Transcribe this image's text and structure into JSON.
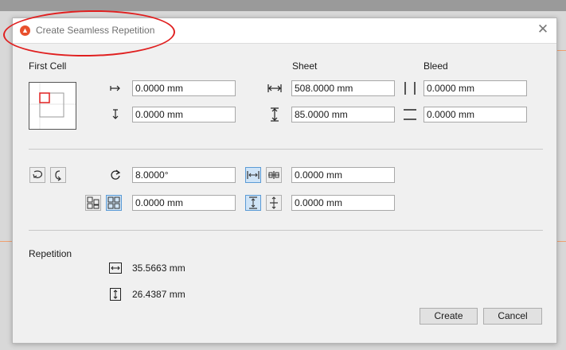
{
  "dialog": {
    "title": "Create Seamless Repetition"
  },
  "first_cell": {
    "heading": "First Cell",
    "x_offset": "0.0000 mm",
    "y_offset": "0.0000 mm"
  },
  "sheet": {
    "heading": "Sheet",
    "width": "508.0000 mm",
    "height": "85.0000 mm"
  },
  "bleed": {
    "heading": "Bleed",
    "horizontal": "0.0000 mm",
    "vertical": "0.0000 mm"
  },
  "transform": {
    "rotation": "8.0000°",
    "offset": "0.0000 mm",
    "h_spacing": "0.0000 mm",
    "v_spacing": "0.0000 mm"
  },
  "repetition": {
    "heading": "Repetition",
    "width": "35.5663 mm",
    "height": "26.4387 mm"
  },
  "buttons": {
    "create": "Create",
    "cancel": "Cancel"
  }
}
